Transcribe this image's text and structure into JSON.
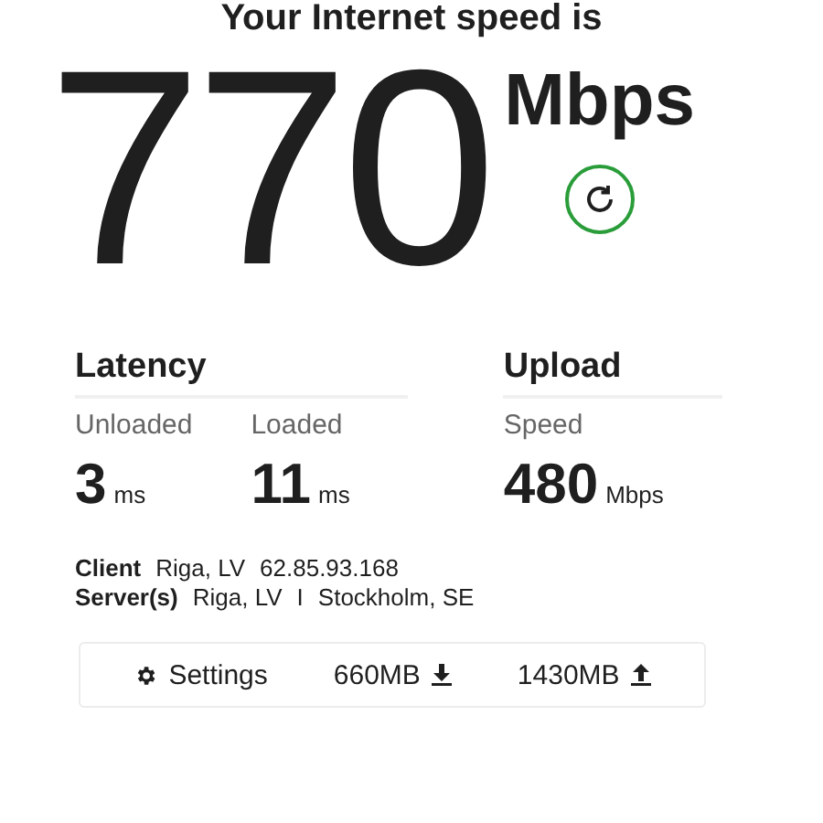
{
  "heading": "Your Internet speed is",
  "speed": {
    "value": "770",
    "unit": "Mbps"
  },
  "groups": [
    {
      "title": "Latency",
      "metrics": [
        {
          "label": "Unloaded",
          "value": "3",
          "unit": "ms"
        },
        {
          "label": "Loaded",
          "value": "11",
          "unit": "ms"
        }
      ]
    },
    {
      "title": "Upload",
      "metrics": [
        {
          "label": "Speed",
          "value": "480",
          "unit": "Mbps"
        }
      ]
    }
  ],
  "info": [
    {
      "label": "Client",
      "parts": [
        "Riga, LV",
        "62.85.93.168"
      ]
    },
    {
      "label": "Server(s)",
      "parts": [
        "Riga, LV",
        "I",
        "Stockholm, SE"
      ]
    }
  ],
  "footer": [
    {
      "kind": "settings",
      "label": "Settings"
    },
    {
      "kind": "download",
      "label": "660MB"
    },
    {
      "kind": "upload",
      "label": "1430MB"
    }
  ]
}
